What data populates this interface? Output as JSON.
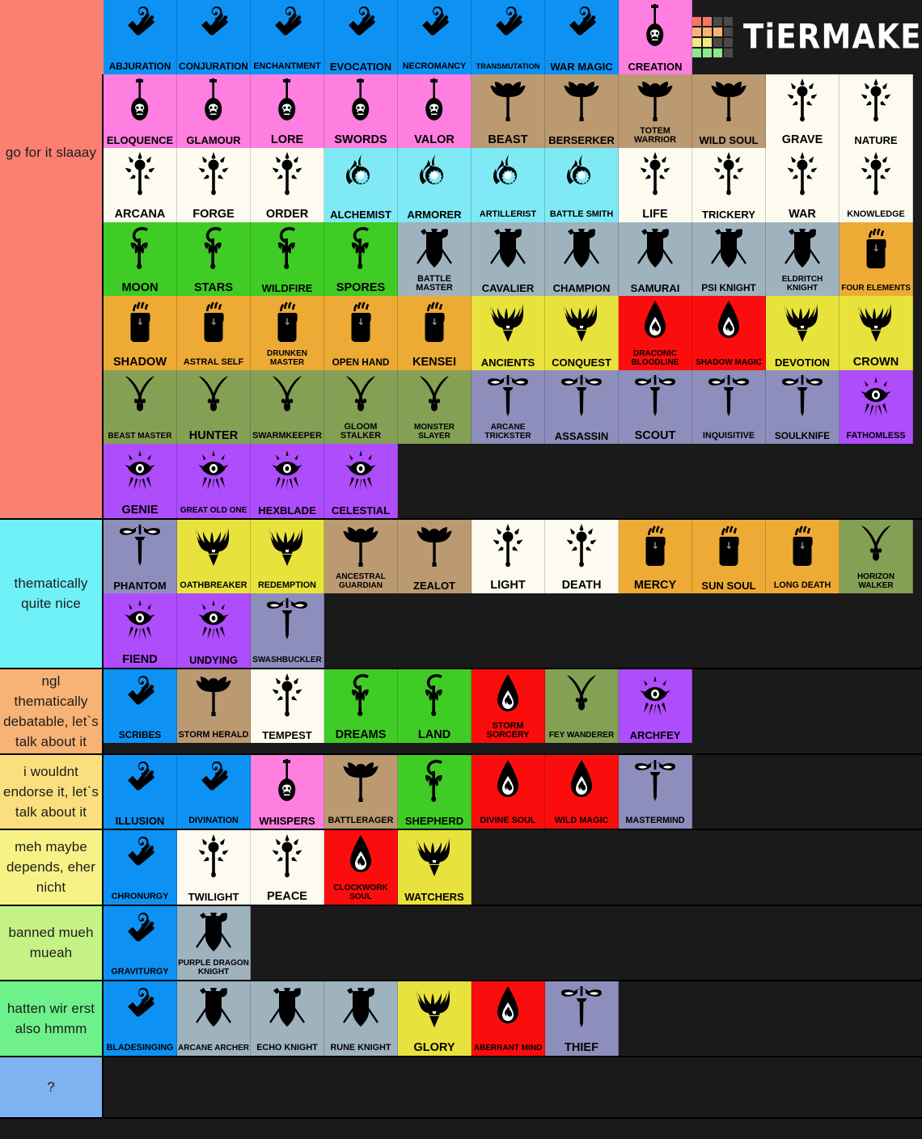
{
  "app": {
    "logo_text": "TiERMAKER"
  },
  "logo_colors": [
    "#f4776a",
    "#f4776a",
    "#4a4a4a",
    "#4a4a4a",
    "#f7b275",
    "#f7b275",
    "#f7b275",
    "#4a4a4a",
    "#f2ea7e",
    "#f2ea7e",
    "#4a4a4a",
    "#4a4a4a",
    "#8ce88c",
    "#8ce88c",
    "#8ce88c",
    "#4a4a4a"
  ],
  "palette": {
    "wizard": "#0d92f4",
    "bard": "#ff7fe0",
    "cleric": "#fdfbf0",
    "artificer": "#7fe9f5",
    "druid": "#3fcc24",
    "fighter": "#9fb3bf",
    "monk": "#edab35",
    "paladin": "#e8e23c",
    "sorcerer": "#fc0d0d",
    "ranger": "#84a055",
    "rogue": "#8e8ebc",
    "warlock": "#ae4dfc",
    "barbarian": "#bb9a72"
  },
  "tiers": [
    {
      "name": "tier-1",
      "label": "go for it slaaay",
      "label_color": "#fa8072",
      "rows": [
        [
          {
            "n": "ABJURATION",
            "c": "wizard",
            "i": "wizard-hand-icon",
            "f": "s12"
          },
          {
            "n": "CONJURATION",
            "c": "wizard",
            "i": "wizard-hand-icon",
            "f": "s12"
          },
          {
            "n": "ENCHANTMENT",
            "c": "wizard",
            "i": "wizard-hand-icon",
            "f": "s11"
          },
          {
            "n": "EVOCATION",
            "c": "wizard",
            "i": "wizard-hand-icon",
            "f": "s13"
          },
          {
            "n": "NECROMANCY",
            "c": "wizard",
            "i": "wizard-hand-icon",
            "f": "s11"
          },
          {
            "n": "TRANSMUTATION",
            "c": "wizard",
            "i": "wizard-hand-icon",
            "f": "s9"
          },
          {
            "n": "WAR MAGIC",
            "c": "wizard",
            "i": "wizard-hand-icon",
            "f": "s13"
          },
          {
            "n": "CREATION",
            "c": "bard",
            "i": "bard-lute-icon",
            "f": "s13"
          }
        ],
        [
          {
            "n": "ELOQUENCE",
            "c": "bard",
            "i": "bard-lute-icon",
            "f": "s13"
          },
          {
            "n": "GLAMOUR",
            "c": "bard",
            "i": "bard-lute-icon",
            "f": "s13"
          },
          {
            "n": "LORE",
            "c": "bard",
            "i": "bard-lute-icon",
            "f": "s14"
          },
          {
            "n": "SWORDS",
            "c": "bard",
            "i": "bard-lute-icon",
            "f": "s14"
          },
          {
            "n": "VALOR",
            "c": "bard",
            "i": "bard-lute-icon",
            "f": "s14"
          },
          {
            "n": "BEAST",
            "c": "barbarian",
            "i": "barbarian-axe-icon",
            "f": "s14"
          },
          {
            "n": "BERSERKER",
            "c": "barbarian",
            "i": "barbarian-axe-icon",
            "f": "s13"
          },
          {
            "n": "TOTEM WARRIOR",
            "c": "barbarian",
            "i": "barbarian-axe-icon",
            "f": "s11"
          },
          {
            "n": "WILD SOUL",
            "c": "barbarian",
            "i": "barbarian-axe-icon",
            "f": "s13"
          },
          {
            "n": "GRAVE",
            "c": "cleric",
            "i": "cleric-mace-icon",
            "f": "s14"
          },
          {
            "n": "NATURE",
            "c": "cleric",
            "i": "cleric-mace-icon",
            "f": "s13"
          }
        ],
        [
          {
            "n": "ARCANA",
            "c": "cleric",
            "i": "cleric-mace-icon",
            "f": "s14"
          },
          {
            "n": "FORGE",
            "c": "cleric",
            "i": "cleric-mace-icon",
            "f": "s14"
          },
          {
            "n": "ORDER",
            "c": "cleric",
            "i": "cleric-mace-icon",
            "f": "s14"
          },
          {
            "n": "ALCHEMIST",
            "c": "artificer",
            "i": "artificer-gear-icon",
            "f": "s13"
          },
          {
            "n": "ARMORER",
            "c": "artificer",
            "i": "artificer-gear-icon",
            "f": "s13"
          },
          {
            "n": "ARTILLERIST",
            "c": "artificer",
            "i": "artificer-gear-icon",
            "f": "s11"
          },
          {
            "n": "BATTLE SMITH",
            "c": "artificer",
            "i": "artificer-gear-icon",
            "f": "s11"
          },
          {
            "n": "LIFE",
            "c": "cleric",
            "i": "cleric-mace-icon",
            "f": "s14"
          },
          {
            "n": "TRICKERY",
            "c": "cleric",
            "i": "cleric-mace-icon",
            "f": "s13"
          },
          {
            "n": "WAR",
            "c": "cleric",
            "i": "cleric-mace-icon",
            "f": "s14"
          },
          {
            "n": "KNOWLEDGE",
            "c": "cleric",
            "i": "cleric-mace-icon",
            "f": "s11"
          }
        ],
        [
          {
            "n": "MOON",
            "c": "druid",
            "i": "druid-staff-icon",
            "f": "s14"
          },
          {
            "n": "STARS",
            "c": "druid",
            "i": "druid-staff-icon",
            "f": "s14"
          },
          {
            "n": "WILDFIRE",
            "c": "druid",
            "i": "druid-staff-icon",
            "f": "s13"
          },
          {
            "n": "SPORES",
            "c": "druid",
            "i": "druid-staff-icon",
            "f": "s14"
          },
          {
            "n": "BATTLE MASTER",
            "c": "fighter",
            "i": "fighter-shield-icon",
            "f": "s11"
          },
          {
            "n": "CAVALIER",
            "c": "fighter",
            "i": "fighter-shield-icon",
            "f": "s13"
          },
          {
            "n": "CHAMPION",
            "c": "fighter",
            "i": "fighter-shield-icon",
            "f": "s13"
          },
          {
            "n": "SAMURAI",
            "c": "fighter",
            "i": "fighter-shield-icon",
            "f": "s13"
          },
          {
            "n": "PSI KNIGHT",
            "c": "fighter",
            "i": "fighter-shield-icon",
            "f": "s12"
          },
          {
            "n": "ELDRITCH KNIGHT",
            "c": "fighter",
            "i": "fighter-shield-icon",
            "f": "s10"
          },
          {
            "n": "FOUR ELEMENTS",
            "c": "monk",
            "i": "monk-fist-icon",
            "f": "s10"
          }
        ],
        [
          {
            "n": "SHADOW",
            "c": "monk",
            "i": "monk-fist-icon",
            "f": "s14"
          },
          {
            "n": "ASTRAL SELF",
            "c": "monk",
            "i": "monk-fist-icon",
            "f": "s11"
          },
          {
            "n": "DRUNKEN MASTER",
            "c": "monk",
            "i": "monk-fist-icon",
            "f": "s10"
          },
          {
            "n": "OPEN HAND",
            "c": "monk",
            "i": "monk-fist-icon",
            "f": "s12"
          },
          {
            "n": "KENSEI",
            "c": "monk",
            "i": "monk-fist-icon",
            "f": "s14"
          },
          {
            "n": "ANCIENTS",
            "c": "paladin",
            "i": "paladin-helm-icon",
            "f": "s13"
          },
          {
            "n": "CONQUEST",
            "c": "paladin",
            "i": "paladin-helm-icon",
            "f": "s13"
          },
          {
            "n": "DRACONIC BLOODLINE",
            "c": "sorcerer",
            "i": "sorcerer-flame-icon",
            "f": "s10"
          },
          {
            "n": "SHADOW MAGIC",
            "c": "sorcerer",
            "i": "sorcerer-flame-icon",
            "f": "s10"
          },
          {
            "n": "DEVOTION",
            "c": "paladin",
            "i": "paladin-helm-icon",
            "f": "s13"
          },
          {
            "n": "CROWN",
            "c": "paladin",
            "i": "paladin-helm-icon",
            "f": "s14"
          }
        ],
        [
          {
            "n": "BEAST MASTER",
            "c": "ranger",
            "i": "ranger-claw-icon",
            "f": "s10"
          },
          {
            "n": "HUNTER",
            "c": "ranger",
            "i": "ranger-claw-icon",
            "f": "s14"
          },
          {
            "n": "SWARMKEEPER",
            "c": "ranger",
            "i": "ranger-claw-icon",
            "f": "s11"
          },
          {
            "n": "GLOOM STALKER",
            "c": "ranger",
            "i": "ranger-claw-icon",
            "f": "s11"
          },
          {
            "n": "MONSTER SLAYER",
            "c": "ranger",
            "i": "ranger-claw-icon",
            "f": "s10"
          },
          {
            "n": "ARCANE TRICKSTER",
            "c": "rogue",
            "i": "rogue-dagger-icon",
            "f": "s10"
          },
          {
            "n": "ASSASSIN",
            "c": "rogue",
            "i": "rogue-dagger-icon",
            "f": "s13"
          },
          {
            "n": "SCOUT",
            "c": "rogue",
            "i": "rogue-dagger-icon",
            "f": "s14"
          },
          {
            "n": "INQUISITIVE",
            "c": "rogue",
            "i": "rogue-dagger-icon",
            "f": "s11"
          },
          {
            "n": "SOULKNIFE",
            "c": "rogue",
            "i": "rogue-dagger-icon",
            "f": "s12"
          },
          {
            "n": "FATHOMLESS",
            "c": "warlock",
            "i": "warlock-eye-icon",
            "f": "s11"
          }
        ],
        [
          {
            "n": "GENIE",
            "c": "warlock",
            "i": "warlock-eye-icon",
            "f": "s14"
          },
          {
            "n": "GREAT OLD ONE",
            "c": "warlock",
            "i": "warlock-eye-icon",
            "f": "s10"
          },
          {
            "n": "HEXBLADE",
            "c": "warlock",
            "i": "warlock-eye-icon",
            "f": "s13"
          },
          {
            "n": "CELESTIAL",
            "c": "warlock",
            "i": "warlock-eye-icon",
            "f": "s13"
          }
        ]
      ]
    },
    {
      "name": "tier-2",
      "label": "thematically quite nice",
      "label_color": "#70f0f7",
      "rows": [
        [
          {
            "n": "PHANTOM",
            "c": "rogue",
            "i": "rogue-dagger-icon",
            "f": "s13"
          },
          {
            "n": "OATHBREAKER",
            "c": "paladin",
            "i": "paladin-helm-icon",
            "f": "s11"
          },
          {
            "n": "REDEMPTION",
            "c": "paladin",
            "i": "paladin-helm-icon",
            "f": "s11"
          },
          {
            "n": "ANCESTRAL GUARDIAN",
            "c": "barbarian",
            "i": "barbarian-axe-icon",
            "f": "s10"
          },
          {
            "n": "ZEALOT",
            "c": "barbarian",
            "i": "barbarian-axe-icon",
            "f": "s13"
          },
          {
            "n": "LIGHT",
            "c": "cleric",
            "i": "cleric-mace-icon",
            "f": "s14"
          },
          {
            "n": "DEATH",
            "c": "cleric",
            "i": "cleric-mace-icon",
            "f": "s14"
          },
          {
            "n": "MERCY",
            "c": "monk",
            "i": "monk-fist-icon",
            "f": "s14"
          },
          {
            "n": "SUN SOUL",
            "c": "monk",
            "i": "monk-fist-icon",
            "f": "s13"
          },
          {
            "n": "LONG DEATH",
            "c": "monk",
            "i": "monk-fist-icon",
            "f": "s11"
          },
          {
            "n": "HORIZON WALKER",
            "c": "ranger",
            "i": "ranger-claw-icon",
            "f": "s10"
          }
        ],
        [
          {
            "n": "FIEND",
            "c": "warlock",
            "i": "warlock-eye-icon",
            "f": "s14"
          },
          {
            "n": "UNDYING",
            "c": "warlock",
            "i": "warlock-eye-icon",
            "f": "s13"
          },
          {
            "n": "SWASHBUCKLER",
            "c": "rogue",
            "i": "rogue-dagger-icon",
            "f": "s10"
          }
        ]
      ]
    },
    {
      "name": "tier-3",
      "label": "ngl thematically debatable, let`s talk about it",
      "label_color": "#f7b275",
      "rows": [
        [
          {
            "n": "SCRIBES",
            "c": "wizard",
            "i": "wizard-hand-icon",
            "f": "s12"
          },
          {
            "n": "STORM HERALD",
            "c": "barbarian",
            "i": "barbarian-axe-icon",
            "f": "s11"
          },
          {
            "n": "TEMPEST",
            "c": "cleric",
            "i": "cleric-mace-icon",
            "f": "s13"
          },
          {
            "n": "DREAMS",
            "c": "druid",
            "i": "druid-staff-icon",
            "f": "s14"
          },
          {
            "n": "LAND",
            "c": "druid",
            "i": "druid-staff-icon",
            "f": "s14"
          },
          {
            "n": "STORM SORCERY",
            "c": "sorcerer",
            "i": "sorcerer-flame-icon",
            "f": "s11"
          },
          {
            "n": "FEY WANDERER",
            "c": "ranger",
            "i": "ranger-claw-icon",
            "f": "s10"
          },
          {
            "n": "ARCHFEY",
            "c": "warlock",
            "i": "warlock-eye-icon",
            "f": "s13"
          }
        ]
      ]
    },
    {
      "name": "tier-4",
      "label": "i wouldnt endorse it, let`s talk about it",
      "label_color": "#fbdf7e",
      "rows": [
        [
          {
            "n": "ILLUSION",
            "c": "wizard",
            "i": "wizard-hand-icon",
            "f": "s13"
          },
          {
            "n": "DIVINATION",
            "c": "wizard",
            "i": "wizard-hand-icon",
            "f": "s11"
          },
          {
            "n": "WHISPERS",
            "c": "bard",
            "i": "bard-lute-icon",
            "f": "s13"
          },
          {
            "n": "BATTLERAGER",
            "c": "barbarian",
            "i": "barbarian-axe-icon",
            "f": "s11"
          },
          {
            "n": "SHEPHERD",
            "c": "druid",
            "i": "druid-staff-icon",
            "f": "s13"
          },
          {
            "n": "DIVINE SOUL",
            "c": "sorcerer",
            "i": "sorcerer-flame-icon",
            "f": "s11"
          },
          {
            "n": "WILD MAGIC",
            "c": "sorcerer",
            "i": "sorcerer-flame-icon",
            "f": "s11"
          },
          {
            "n": "MASTERMIND",
            "c": "rogue",
            "i": "rogue-dagger-icon",
            "f": "s11"
          }
        ]
      ]
    },
    {
      "name": "tier-5",
      "label": "meh maybe depends, eher nicht",
      "label_color": "#f7f286",
      "rows": [
        [
          {
            "n": "CHRONURGY",
            "c": "wizard",
            "i": "wizard-hand-icon",
            "f": "s11"
          },
          {
            "n": "TWILIGHT",
            "c": "cleric",
            "i": "cleric-mace-icon",
            "f": "s13"
          },
          {
            "n": "PEACE",
            "c": "cleric",
            "i": "cleric-mace-icon",
            "f": "s14"
          },
          {
            "n": "CLOCKWORK SOUL",
            "c": "sorcerer",
            "i": "sorcerer-flame-icon",
            "f": "s10"
          },
          {
            "n": "WATCHERS",
            "c": "paladin",
            "i": "paladin-helm-icon",
            "f": "s13"
          }
        ]
      ]
    },
    {
      "name": "tier-6",
      "label": "banned mueh mueah",
      "label_color": "#c4f285",
      "rows": [
        [
          {
            "n": "GRAVITURGY",
            "c": "wizard",
            "i": "wizard-hand-icon",
            "f": "s11"
          },
          {
            "n": "PURPLE DRAGON KNIGHT",
            "c": "fighter",
            "i": "fighter-shield-icon",
            "f": "s10"
          }
        ]
      ]
    },
    {
      "name": "tier-7",
      "label": "hatten wir erst also hmmm",
      "label_color": "#6ef08a",
      "rows": [
        [
          {
            "n": "BLADESINGING",
            "c": "wizard",
            "i": "wizard-hand-icon",
            "f": "s11"
          },
          {
            "n": "ARCANE ARCHER",
            "c": "fighter",
            "i": "fighter-shield-icon",
            "f": "s10"
          },
          {
            "n": "ECHO KNIGHT",
            "c": "fighter",
            "i": "fighter-shield-icon",
            "f": "s11"
          },
          {
            "n": "RUNE KNIGHT",
            "c": "fighter",
            "i": "fighter-shield-icon",
            "f": "s11"
          },
          {
            "n": "GLORY",
            "c": "paladin",
            "i": "paladin-helm-icon",
            "f": "s14"
          },
          {
            "n": "ABERRANT MIND",
            "c": "sorcerer",
            "i": "sorcerer-flame-icon",
            "f": "s10"
          },
          {
            "n": "THIEF",
            "c": "rogue",
            "i": "rogue-dagger-icon",
            "f": "s14"
          }
        ]
      ]
    },
    {
      "name": "tier-8",
      "label": "?",
      "label_color": "#7eb2f0",
      "rows": [
        []
      ]
    }
  ]
}
